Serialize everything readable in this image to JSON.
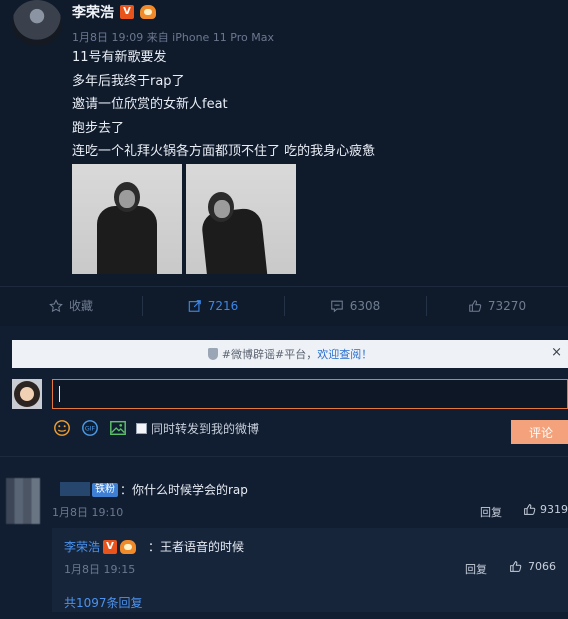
{
  "post": {
    "author": "李荣浩",
    "meta": "1月8日 19:09 来自 iPhone 11 Pro Max",
    "lines": [
      "11号有新歌要发",
      "多年后我终于rap了",
      "邀请一位欣赏的女新人feat",
      "跑步去了",
      "连吃一个礼拜火锅各方面都顶不住了 吃的我身心疲惫"
    ],
    "v_badge": "V"
  },
  "actions": {
    "favorite_label": "收藏",
    "repost_count": "7216",
    "comment_count": "6308",
    "like_count": "73270"
  },
  "notice": {
    "prefix": "#微博辟谣#平台，",
    "link": "欢迎查阅！",
    "close": "×"
  },
  "composer": {
    "forward_label": "同时转发到我的微博",
    "submit_label": "评论"
  },
  "comment": {
    "fan_badge": "铁粉",
    "text": "：你什么时候学会的rap",
    "time": "1月8日 19:10",
    "reply_label": "回复",
    "like_count": "9319"
  },
  "sub_reply": {
    "author": "李荣浩",
    "v_badge": "V",
    "text": "：王者语音的时候",
    "time": "1月8日 19:15",
    "reply_label": "回复",
    "like_count": "7066",
    "total_label": "共1097条回复"
  },
  "colors": {
    "background": "#0f1a2b",
    "accent_orange": "#e5783a",
    "link_blue": "#4b93ee",
    "active_blue": "#3d86e6"
  }
}
